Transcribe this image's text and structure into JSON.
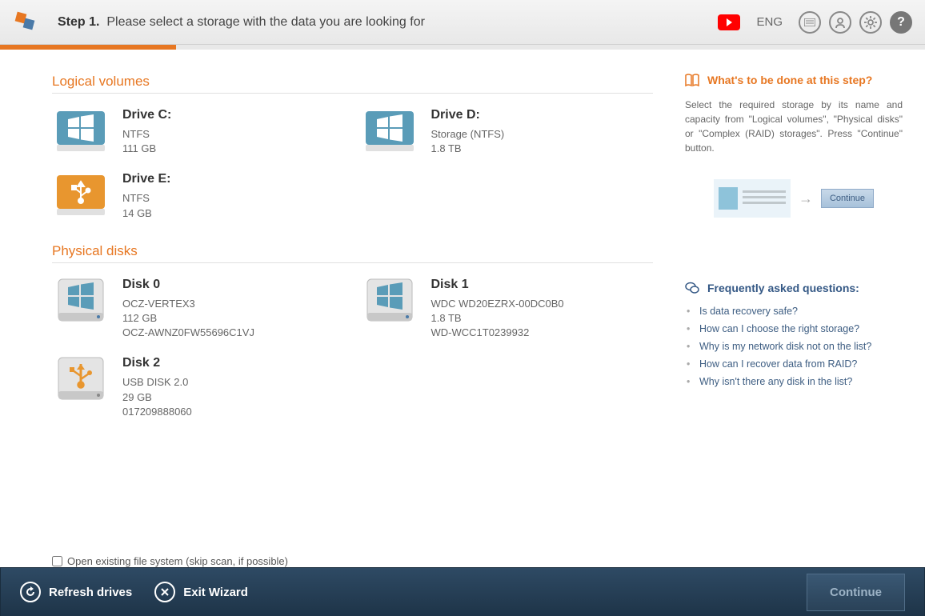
{
  "header": {
    "step_bold": "Step 1.",
    "step_text": "Please select a storage with the data you are looking for",
    "lang": "ENG"
  },
  "sections": {
    "logical": "Logical volumes",
    "physical": "Physical disks"
  },
  "logical_drives": [
    {
      "name": "Drive C:",
      "fs": "NTFS",
      "size": "111 GB",
      "serial": "",
      "variant": "win"
    },
    {
      "name": "Drive D:",
      "fs": "Storage (NTFS)",
      "size": "1.8 TB",
      "serial": "",
      "variant": "win"
    },
    {
      "name": "Drive E:",
      "fs": "NTFS",
      "size": "14 GB",
      "serial": "",
      "variant": "usb"
    }
  ],
  "physical_disks": [
    {
      "name": "Disk 0",
      "model": "OCZ-VERTEX3",
      "size": "112 GB",
      "serial": "OCZ-AWNZ0FW55696C1VJ",
      "variant": "disk"
    },
    {
      "name": "Disk 1",
      "model": "WDC WD20EZRX-00DC0B0",
      "size": "1.8 TB",
      "serial": "WD-WCC1T0239932",
      "variant": "disk"
    },
    {
      "name": "Disk 2",
      "model": "USB DISK 2.0",
      "size": "29 GB",
      "serial": "017209888060",
      "variant": "usbdisk"
    }
  ],
  "checkbox_label": "Open existing file system (skip scan, if possible)",
  "sidebar": {
    "help_title": "What's to be done at this step?",
    "help_text": "Select the required storage by its name and capacity from \"Logical volumes\", \"Physical disks\" or \"Complex (RAID) storages\". Press \"Continue\" button.",
    "illus_btn": "Continue",
    "faq_title": "Frequently asked questions:",
    "faq": [
      "Is data recovery safe?",
      "How can I choose the right storage?",
      "Why is my network disk not on the list?",
      "How can I recover data from RAID?",
      "Why isn't there any disk in the list?"
    ]
  },
  "footer": {
    "refresh": "Refresh drives",
    "exit": "Exit Wizard",
    "continue": "Continue"
  }
}
